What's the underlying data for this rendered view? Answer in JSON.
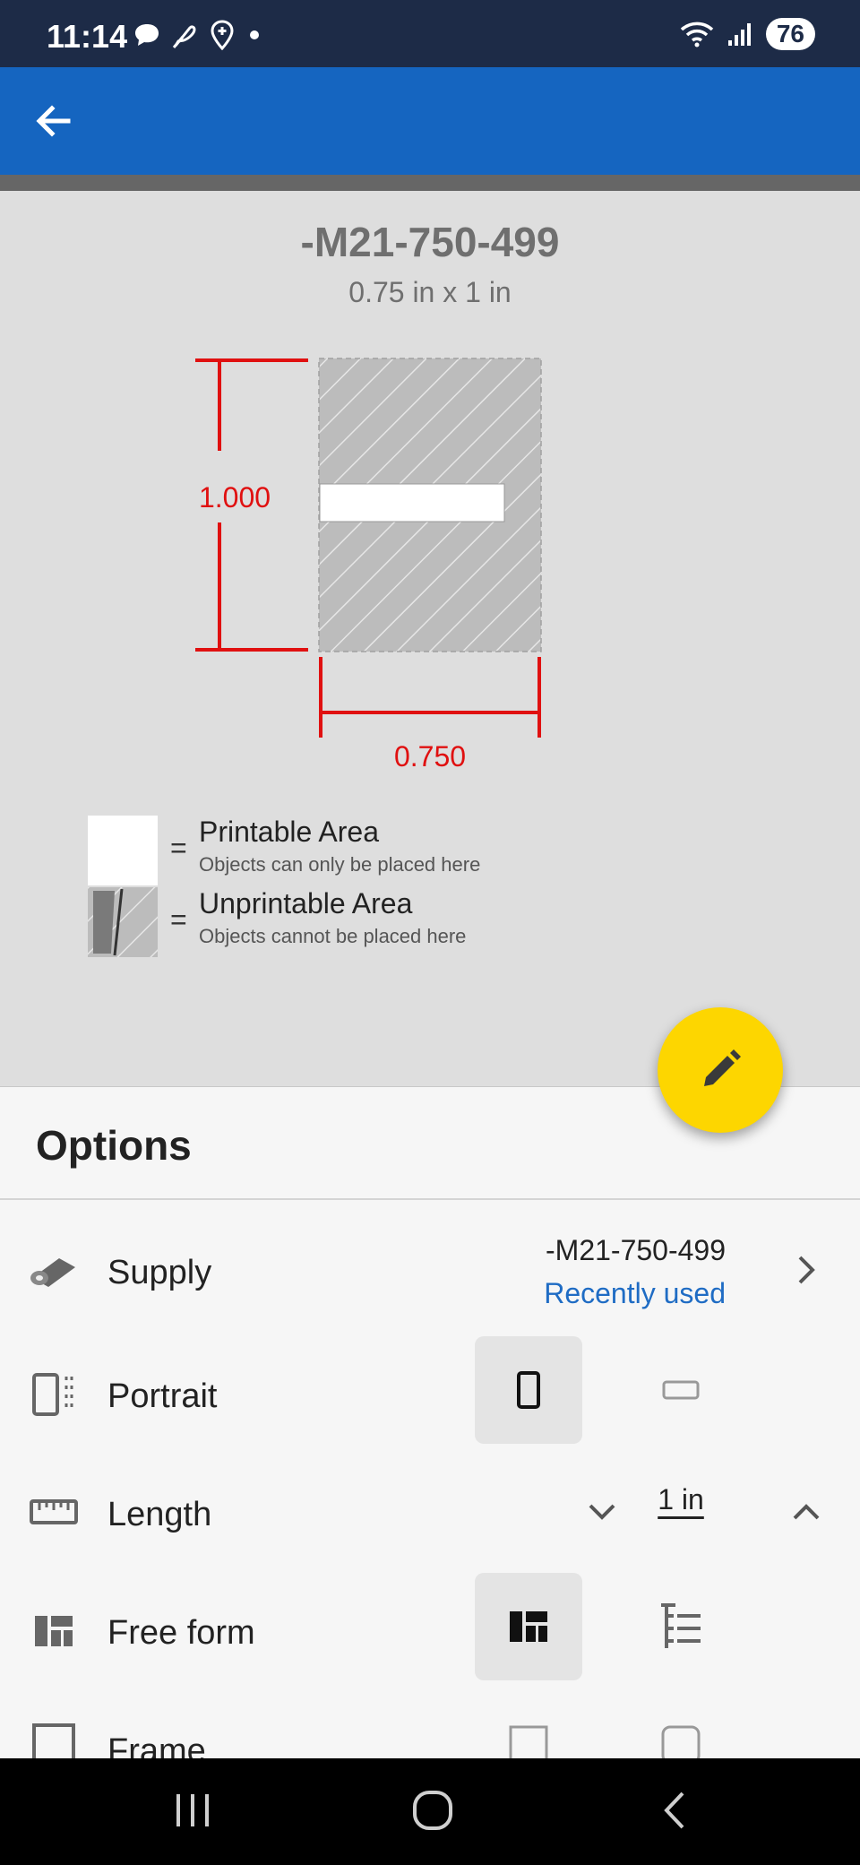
{
  "status_bar": {
    "time": "11:14",
    "battery": "76",
    "left_icons": [
      "chat-bubble-icon",
      "feather-icon",
      "location-pin-icon",
      "dot-icon"
    ],
    "right_icons": [
      "wifi-icon",
      "signal-icon"
    ]
  },
  "app_bar": {
    "back_icon": "arrow-back-icon",
    "color": "#1565c0"
  },
  "preview": {
    "title": "-M21-750-499",
    "size": "0.75 in x 1 in",
    "height_dim": "1.000",
    "width_dim": "0.750",
    "dimension_color": "#e01010"
  },
  "legend": {
    "equals": "=",
    "printable_title": "Printable Area",
    "printable_sub": "Objects can only be placed here",
    "unprintable_title": "Unprintable Area",
    "unprintable_sub": "Objects cannot be placed here"
  },
  "fab": {
    "icon": "pencil-icon",
    "color": "#fdd600"
  },
  "options": {
    "title": "Options",
    "supply": {
      "label": "Supply",
      "value": "-M21-750-499",
      "sub": "Recently used"
    },
    "orientation": {
      "label": "Portrait",
      "selected": "portrait"
    },
    "length": {
      "label": "Length",
      "value": "1 in"
    },
    "layout": {
      "label": "Free form",
      "selected": "free-form"
    },
    "frame": {
      "label": "Frame"
    }
  },
  "nav_bar": {
    "buttons": [
      "recents-icon",
      "home-icon",
      "back-icon"
    ]
  }
}
